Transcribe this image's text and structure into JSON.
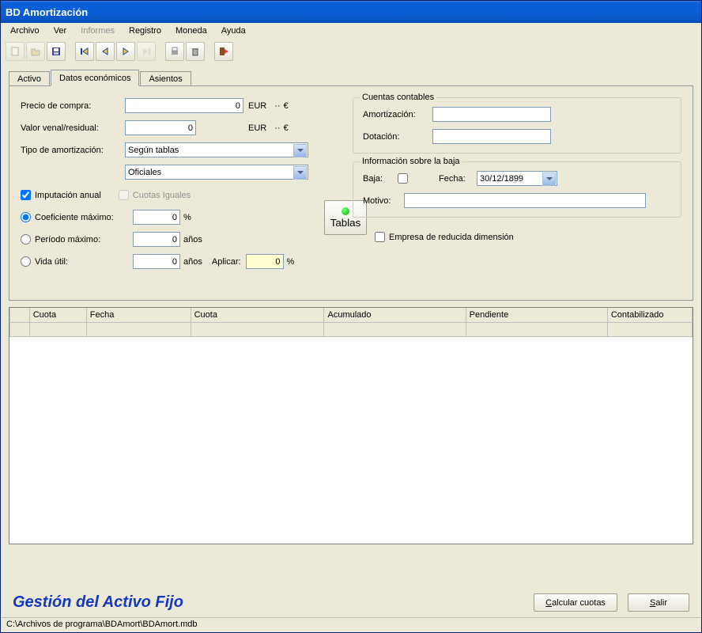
{
  "window": {
    "title": "BD Amortización"
  },
  "menu": {
    "archivo": "Archivo",
    "ver": "Ver",
    "informes": "Informes",
    "registro": "Registro",
    "moneda": "Moneda",
    "ayuda": "Ayuda"
  },
  "tabs": {
    "activo": "Activo",
    "datos": "Datos económicos",
    "asientos": "Asientos"
  },
  "form": {
    "precio_label": "Precio de compra:",
    "precio_value": "0",
    "valor_label": "Valor venal/residual:",
    "valor_value": "0",
    "currency": "EUR",
    "tilde_sep": "··",
    "euro": "€",
    "tipo_label": "Tipo de amortización:",
    "tipo_value": "Según tablas",
    "subtipo_value": "Oficiales",
    "imputacion_label": "Imputación anual",
    "cuotas_label": "Cuotas Iguales",
    "coef_label": "Coeficiente máximo:",
    "coef_value": "0",
    "pct": "%",
    "periodo_label": "Período máximo:",
    "periodo_value": "0",
    "anos": "años",
    "vida_label": "Vida útil:",
    "vida_value": "0",
    "aplicar_label": "Aplicar:",
    "aplicar_value": "0",
    "tablas_btn": "Tablas"
  },
  "cuentas": {
    "legend": "Cuentas contables",
    "amort_label": "Amortización:",
    "amort_value": "",
    "dot_label": "Dotación:",
    "dot_value": ""
  },
  "baja": {
    "legend": "Información sobre la baja",
    "baja_label": "Baja:",
    "fecha_label": "Fecha:",
    "fecha_value": "30/12/1899",
    "motivo_label": "Motivo:",
    "motivo_value": ""
  },
  "empresa_label": "Empresa de reducida dimensión",
  "grid": {
    "headers": [
      "",
      "Cuota",
      "Fecha",
      "Cuota",
      "Acumulado",
      "Pendiente",
      "Contabilizado"
    ]
  },
  "footer": {
    "brand": "Gestión del Activo Fijo",
    "calcular": "Calcular cuotas",
    "salir": "Salir"
  },
  "statusbar": "C:\\Archivos de programa\\BDAmort\\BDAmort.mdb"
}
